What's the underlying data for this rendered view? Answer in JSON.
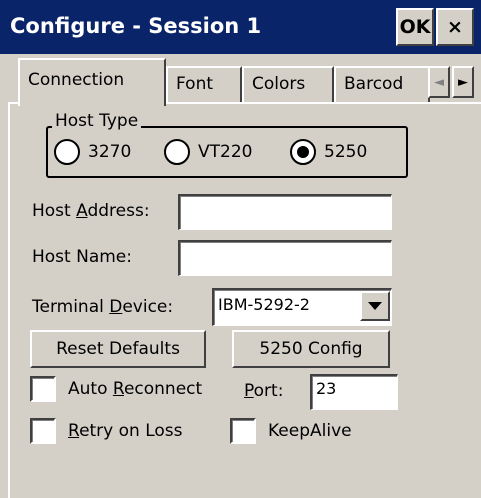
{
  "window": {
    "title": "Configure - Session 1",
    "ok_label": "OK",
    "close_label": "×"
  },
  "tabs": [
    {
      "label": "Connection",
      "active": true
    },
    {
      "label": "Font",
      "active": false
    },
    {
      "label": "Colors",
      "active": false
    },
    {
      "label": "Barcod",
      "active": false
    }
  ],
  "tab_scroll": {
    "left": "◄",
    "right": "►"
  },
  "host_type": {
    "legend": "Host Type",
    "options": [
      {
        "label": "3270",
        "selected": false
      },
      {
        "label": "VT220",
        "selected": false
      },
      {
        "label": "5250",
        "selected": true
      }
    ]
  },
  "host_address": {
    "label_pre": "Host ",
    "label_accel": "A",
    "label_post": "ddress:",
    "value": ""
  },
  "host_name": {
    "label": "Host Name:",
    "value": ""
  },
  "terminal_device": {
    "label_pre": "Terminal ",
    "label_accel": "D",
    "label_post": "evice:",
    "value": "IBM-5292-2"
  },
  "buttons": {
    "reset": "Reset Defaults",
    "config": "5250 Config"
  },
  "auto_reconnect": {
    "label_pre": "Auto ",
    "label_accel": "R",
    "label_post": "econnect",
    "checked": false
  },
  "port": {
    "label_accel": "P",
    "label_post": "ort:",
    "value": "23"
  },
  "retry_on_loss": {
    "label_accel": "R",
    "label_post": "etry on Loss",
    "checked": false
  },
  "keepalive": {
    "label": "KeepAlive",
    "checked": false
  }
}
